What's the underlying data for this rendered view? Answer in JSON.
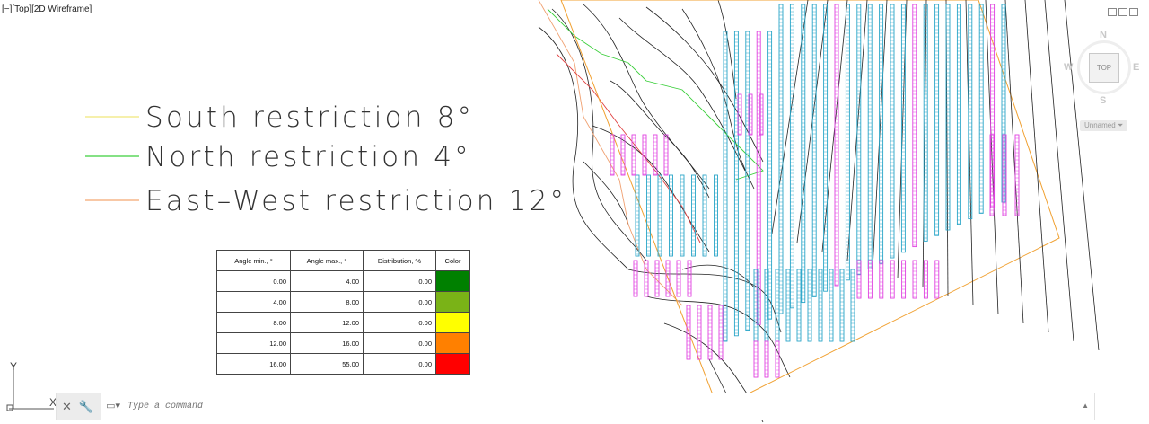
{
  "viewport": {
    "label": "[−][Top][2D Wireframe]"
  },
  "legend": {
    "items": [
      {
        "label": "South restriction 8°",
        "color": "#f0e87a"
      },
      {
        "label": "North restriction 4°",
        "color": "#3ccf3c"
      },
      {
        "label": "East–West restriction 12°",
        "color": "#f4a870"
      }
    ]
  },
  "table": {
    "headers": [
      "Angle min., °",
      "Angle max., °",
      "Distribution, %",
      "Color"
    ],
    "rows": [
      {
        "min": "0.00",
        "max": "4.00",
        "dist": "0.00",
        "color": "#008000"
      },
      {
        "min": "4.00",
        "max": "8.00",
        "dist": "0.00",
        "color": "#7ab317"
      },
      {
        "min": "8.00",
        "max": "12.00",
        "dist": "0.00",
        "color": "#ffff00"
      },
      {
        "min": "12.00",
        "max": "16.00",
        "dist": "0.00",
        "color": "#ff8000"
      },
      {
        "min": "16.00",
        "max": "55.00",
        "dist": "0.00",
        "color": "#ff0000"
      }
    ]
  },
  "viewcube": {
    "north": "N",
    "south": "S",
    "east": "E",
    "west": "W",
    "face": "TOP",
    "wcs_menu": "Unnamed"
  },
  "ucs": {
    "x_label": "X",
    "y_label": "Y"
  },
  "command_line": {
    "placeholder": "Type a command"
  },
  "colors": {
    "panel_cyan": "#2aa6c8",
    "panel_magenta": "#e040e0",
    "contour": "#222222",
    "boundary_orange": "#f0a030",
    "restriction_red": "#e04040"
  }
}
